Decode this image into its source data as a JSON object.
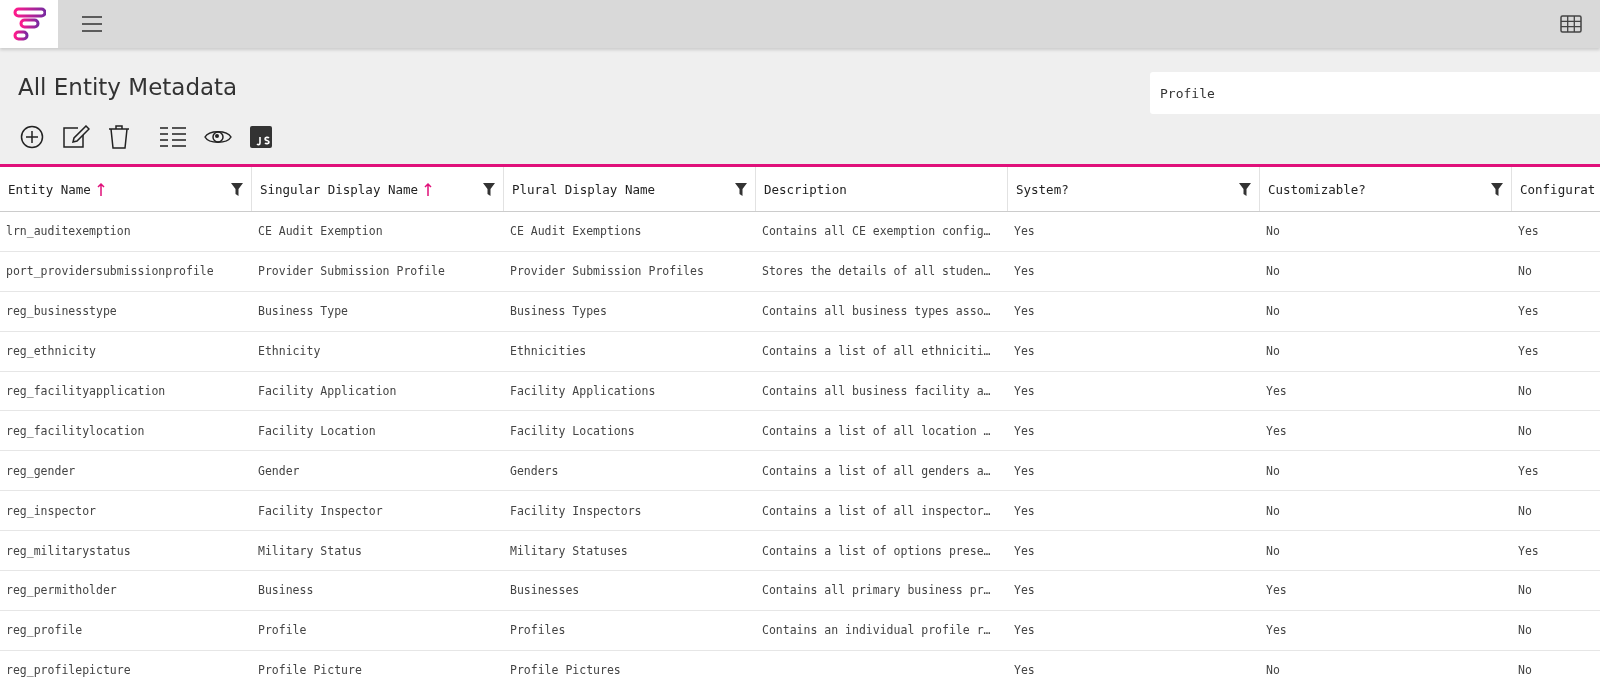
{
  "page": {
    "title": "All Entity Metadata"
  },
  "search": {
    "value": "Profile"
  },
  "table": {
    "columns": [
      {
        "label": "Entity Name",
        "sorted": true,
        "filterable": true
      },
      {
        "label": "Singular Display Name",
        "sorted": true,
        "filterable": true
      },
      {
        "label": "Plural Display Name",
        "sorted": false,
        "filterable": true
      },
      {
        "label": "Description",
        "sorted": false,
        "filterable": false
      },
      {
        "label": "System?",
        "sorted": false,
        "filterable": true
      },
      {
        "label": "Customizable?",
        "sorted": false,
        "filterable": true
      },
      {
        "label": "Configurat"
      }
    ],
    "rows": [
      [
        "lrn_auditexemption",
        "CE Audit Exemption",
        "CE Audit Exemptions",
        "Contains all CE exemption config…",
        "Yes",
        "No",
        "Yes"
      ],
      [
        "port_providersubmissionprofile",
        "Provider Submission Profile",
        "Provider Submission Profiles",
        "Stores the details of all studen…",
        "Yes",
        "No",
        "No"
      ],
      [
        "reg_businesstype",
        "Business Type",
        "Business Types",
        "Contains all business types asso…",
        "Yes",
        "No",
        "Yes"
      ],
      [
        "reg_ethnicity",
        "Ethnicity",
        "Ethnicities",
        "Contains a list of all ethniciti…",
        "Yes",
        "No",
        "Yes"
      ],
      [
        "reg_facilityapplication",
        "Facility Application",
        "Facility Applications",
        "Contains all business facility a…",
        "Yes",
        "Yes",
        "No"
      ],
      [
        "reg_facilitylocation",
        "Facility Location",
        "Facility Locations",
        "Contains a list of all location …",
        "Yes",
        "Yes",
        "No"
      ],
      [
        "reg_gender",
        "Gender",
        "Genders",
        "Contains a list of all genders a…",
        "Yes",
        "No",
        "Yes"
      ],
      [
        "reg_inspector",
        "Facility Inspector",
        "Facility Inspectors",
        "Contains a list of all inspector…",
        "Yes",
        "No",
        "No"
      ],
      [
        "reg_militarystatus",
        "Military Status",
        "Military Statuses",
        "Contains a list of options prese…",
        "Yes",
        "No",
        "Yes"
      ],
      [
        "reg_permitholder",
        "Business",
        "Businesses",
        "Contains all primary business pr…",
        "Yes",
        "Yes",
        "No"
      ],
      [
        "reg_profile",
        "Profile",
        "Profiles",
        "Contains an individual profile r…",
        "Yes",
        "Yes",
        "No"
      ],
      [
        "reg_profilepicture",
        "Profile Picture",
        "Profile Pictures",
        "",
        "Yes",
        "No",
        "No"
      ]
    ]
  }
}
